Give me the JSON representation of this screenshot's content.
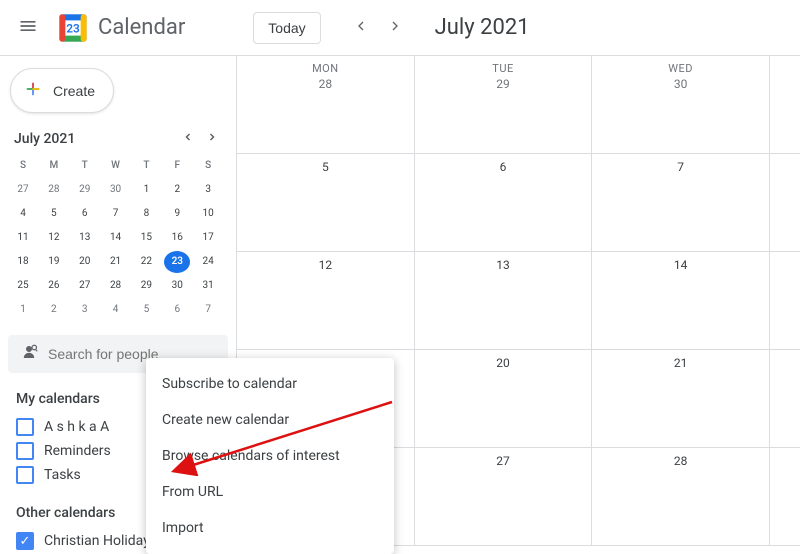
{
  "app": {
    "name": "Calendar"
  },
  "header": {
    "today_label": "Today",
    "current": "July 2021"
  },
  "sidebar": {
    "create_label": "Create",
    "mini": {
      "title": "July 2021",
      "dow": [
        "S",
        "M",
        "T",
        "W",
        "T",
        "F",
        "S"
      ],
      "rows": [
        [
          {
            "n": 27,
            "o": true
          },
          {
            "n": 28,
            "o": true
          },
          {
            "n": 29,
            "o": true
          },
          {
            "n": 30,
            "o": true
          },
          {
            "n": 1
          },
          {
            "n": 2
          },
          {
            "n": 3
          }
        ],
        [
          {
            "n": 4
          },
          {
            "n": 5
          },
          {
            "n": 6
          },
          {
            "n": 7
          },
          {
            "n": 8
          },
          {
            "n": 9
          },
          {
            "n": 10
          }
        ],
        [
          {
            "n": 11
          },
          {
            "n": 12
          },
          {
            "n": 13
          },
          {
            "n": 14
          },
          {
            "n": 15
          },
          {
            "n": 16
          },
          {
            "n": 17
          }
        ],
        [
          {
            "n": 18
          },
          {
            "n": 19
          },
          {
            "n": 20
          },
          {
            "n": 21
          },
          {
            "n": 22
          },
          {
            "n": 23,
            "t": true
          },
          {
            "n": 24
          }
        ],
        [
          {
            "n": 25
          },
          {
            "n": 26
          },
          {
            "n": 27
          },
          {
            "n": 28
          },
          {
            "n": 29
          },
          {
            "n": 30
          },
          {
            "n": 31
          }
        ],
        [
          {
            "n": 1,
            "o": true
          },
          {
            "n": 2,
            "o": true
          },
          {
            "n": 3,
            "o": true
          },
          {
            "n": 4,
            "o": true
          },
          {
            "n": 5,
            "o": true
          },
          {
            "n": 6,
            "o": true
          },
          {
            "n": 7,
            "o": true
          }
        ]
      ]
    },
    "search_placeholder": "Search for people",
    "my_calendars": {
      "title": "My calendars",
      "items": [
        {
          "label": "A s h k a A",
          "color": "#4285f4",
          "checked": false
        },
        {
          "label": "Reminders",
          "color": "#4285f4",
          "checked": false
        },
        {
          "label": "Tasks",
          "color": "#4285f4",
          "checked": false
        }
      ]
    },
    "other_calendars": {
      "title": "Other calendars",
      "items": [
        {
          "label": "Christian Holidays",
          "color": "#4285f4",
          "checked": true
        }
      ]
    }
  },
  "popup": {
    "items": [
      "Subscribe to calendar",
      "Create new calendar",
      "Browse calendars of interest",
      "From URL",
      "Import"
    ]
  },
  "grid_rows": [
    [
      {
        "dow": "MON",
        "num": 28,
        "other": true
      },
      {
        "dow": "TUE",
        "num": 29,
        "other": true
      },
      {
        "dow": "WED",
        "num": 30,
        "other": true
      }
    ],
    [
      {
        "num": 5
      },
      {
        "num": 6
      },
      {
        "num": 7
      }
    ],
    [
      {
        "num": 12
      },
      {
        "num": 13
      },
      {
        "num": 14
      }
    ],
    [
      {
        "num": ""
      },
      {
        "num": 20
      },
      {
        "num": 21
      }
    ],
    [
      {
        "num": ""
      },
      {
        "num": 27
      },
      {
        "num": 28
      }
    ]
  ],
  "colors": {
    "accent": "#1a73e8"
  }
}
